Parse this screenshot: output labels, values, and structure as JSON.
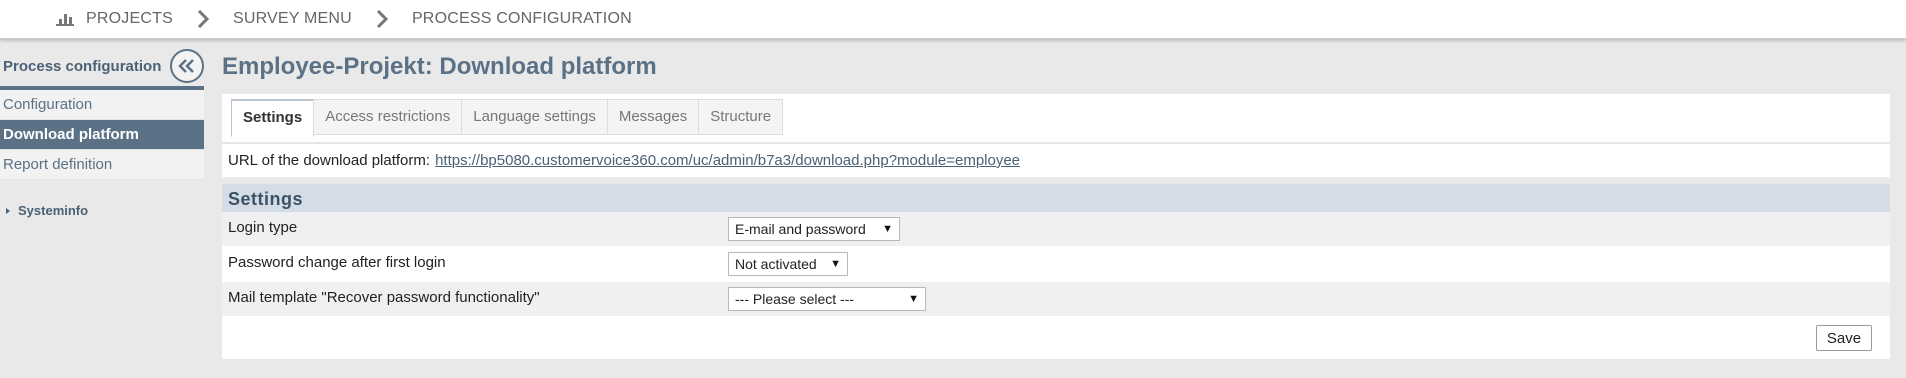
{
  "breadcrumb": {
    "items": [
      "PROJECTS",
      "SURVEY MENU",
      "PROCESS CONFIGURATION"
    ],
    "icon": "bar-chart-icon"
  },
  "sidebar": {
    "title": "Process configuration",
    "items": [
      {
        "label": "Configuration"
      },
      {
        "label": "Download platform"
      },
      {
        "label": "Report definition"
      }
    ],
    "systeminfo": "Systeminfo"
  },
  "main": {
    "title": "Employee-Projekt: Download platform",
    "tabs": [
      {
        "label": "Settings"
      },
      {
        "label": "Access restrictions"
      },
      {
        "label": "Language settings"
      },
      {
        "label": "Messages"
      },
      {
        "label": "Structure"
      }
    ],
    "url_label": "URL of the download platform:",
    "url_value": "https://bp5080.customervoice360.com/uc/admin/b7a3/download.php?module=employee"
  },
  "settings": {
    "heading": "Settings",
    "rows": [
      {
        "label": "Login type",
        "value": "E-mail and password"
      },
      {
        "label": "Password change after first login",
        "value": "Not activated"
      },
      {
        "label": "Mail template \"Recover password functionality\"",
        "value": "--- Please select ---"
      }
    ],
    "save_label": "Save"
  },
  "colors": {
    "accent": "#5b7286",
    "section_header": "#d4dde5",
    "background": "#e9e9e9"
  }
}
